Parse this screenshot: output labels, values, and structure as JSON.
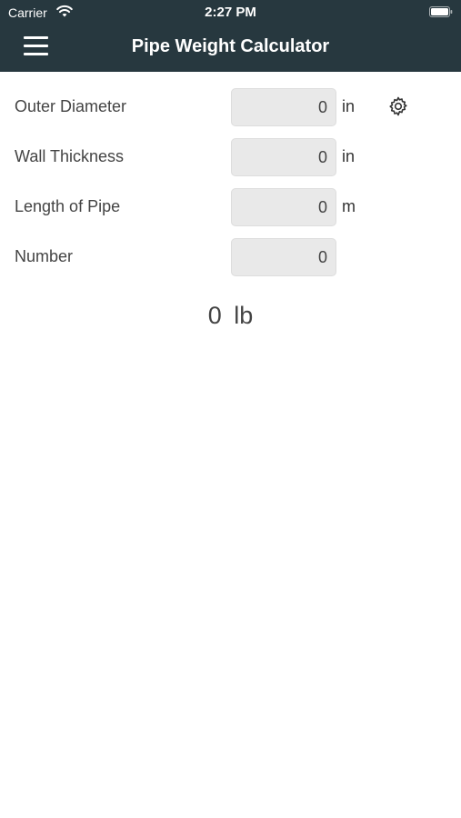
{
  "status_bar": {
    "carrier": "Carrier",
    "time": "2:27 PM",
    "wifi_icon": "wifi-icon",
    "battery_icon": "battery-full-icon"
  },
  "header": {
    "title": "Pipe Weight Calculator",
    "menu_icon": "hamburger-menu-icon",
    "background_color": "#27383f"
  },
  "form": {
    "outer_diameter": {
      "label": "Outer Diameter",
      "value": "0",
      "unit": "in"
    },
    "wall_thickness": {
      "label": "Wall Thickness",
      "value": "0",
      "unit": "in"
    },
    "length": {
      "label": "Length of Pipe",
      "value": "0",
      "unit": "m"
    },
    "number": {
      "label": "Number",
      "value": "0"
    }
  },
  "settings_icon": "gear-icon",
  "result": {
    "value": "0",
    "unit": "lb"
  }
}
